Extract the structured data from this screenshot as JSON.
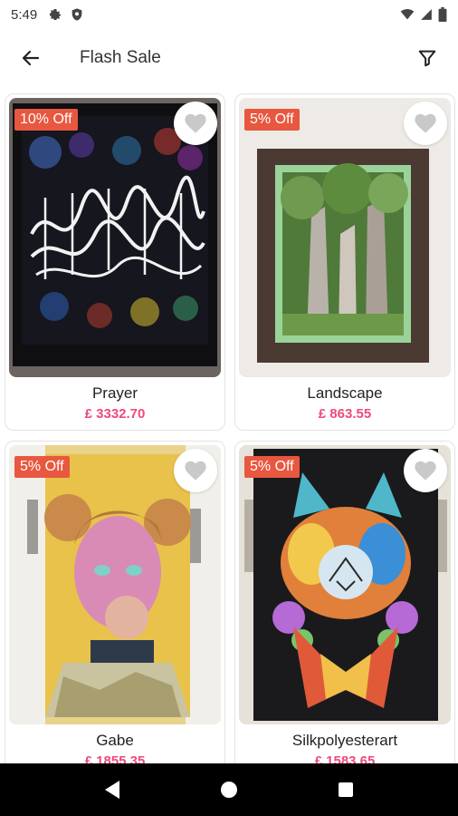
{
  "status_bar": {
    "time": "5:49",
    "left_icons": [
      "gear-icon",
      "shield-icon"
    ],
    "right_icons": [
      "wifi-icon",
      "signal-icon",
      "battery-icon"
    ]
  },
  "app_bar": {
    "title": "Flash Sale",
    "back_icon": "arrow-left-icon",
    "filter_icon": "filter-icon"
  },
  "products": [
    {
      "name": "Prayer",
      "price": "£ 3332.70",
      "discount": "10% Off",
      "image": "framed arabic calligraphy artwork"
    },
    {
      "name": "Landscape",
      "price": "£ 863.55",
      "discount": "5% Off",
      "image": "framed forest painting"
    },
    {
      "name": "Gabe",
      "price": "£ 1855.35",
      "discount": "5% Off",
      "image": "colorful portrait painting"
    },
    {
      "name": "Silkpolyesterart",
      "price": "£ 1583.65",
      "discount": "5% Off",
      "image": "colorful textile art with birds"
    }
  ],
  "colors": {
    "badge": "#e8573f",
    "price": "#ee4a7a",
    "nav_bar": "#000000"
  },
  "nav_bar": {
    "buttons": [
      "back-triangle-icon",
      "home-circle-icon",
      "recents-square-icon"
    ]
  }
}
